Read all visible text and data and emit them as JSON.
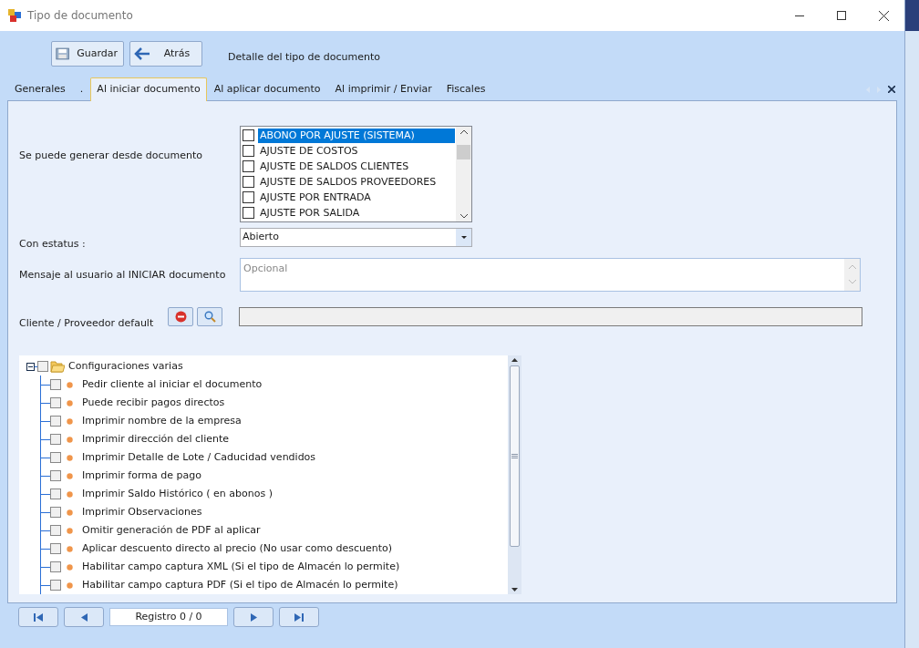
{
  "window": {
    "title": "Tipo de documento"
  },
  "toolbar": {
    "buttons": [
      {
        "label": "Guardar",
        "kind": "save"
      },
      {
        "label": "Atrás",
        "kind": "back"
      }
    ],
    "heading": "Detalle del tipo de documento"
  },
  "tabs": [
    {
      "label": "Generales",
      "selected": false
    },
    {
      "label": ".",
      "selected": false
    },
    {
      "label": "Al iniciar documento",
      "selected": true
    },
    {
      "label": "Al aplicar documento",
      "selected": false
    },
    {
      "label": "Al imprimir / Enviar",
      "selected": false
    },
    {
      "label": "Fiscales",
      "selected": false
    }
  ],
  "form": {
    "generate_from": {
      "label": "Se puede generar desde documento",
      "items": [
        {
          "label": "ABONO POR AJUSTE (SISTEMA)",
          "checked": false,
          "selected": true
        },
        {
          "label": "AJUSTE DE COSTOS",
          "checked": false,
          "selected": false
        },
        {
          "label": "AJUSTE DE SALDOS CLIENTES",
          "checked": false,
          "selected": false
        },
        {
          "label": "AJUSTE DE SALDOS PROVEEDORES",
          "checked": false,
          "selected": false
        },
        {
          "label": "AJUSTE POR ENTRADA",
          "checked": false,
          "selected": false
        },
        {
          "label": "AJUSTE POR SALIDA",
          "checked": false,
          "selected": false
        }
      ]
    },
    "status": {
      "label": "Con estatus :",
      "value": "Abierto"
    },
    "message": {
      "label": "Mensaje al usuario al INICIAR documento",
      "placeholder": "Opcional"
    },
    "partner": {
      "label": "Cliente / Proveedor default"
    }
  },
  "tree": {
    "label": "Configuraciones varias",
    "expanded": true,
    "checked": false,
    "children": [
      {
        "label": "Pedir cliente al iniciar el documento",
        "checked": false
      },
      {
        "label": "Puede recibir pagos directos",
        "checked": false
      },
      {
        "label": "Imprimir nombre de la empresa",
        "checked": false
      },
      {
        "label": "Imprimir dirección del cliente",
        "checked": false
      },
      {
        "label": "Imprimir Detalle de Lote / Caducidad vendidos",
        "checked": false
      },
      {
        "label": "Imprimir forma de pago",
        "checked": false
      },
      {
        "label": "Imprimir Saldo Histórico ( en abonos )",
        "checked": false
      },
      {
        "label": "Imprimir Observaciones",
        "checked": false
      },
      {
        "label": "Omitir generación de PDF al aplicar",
        "checked": false
      },
      {
        "label": "Aplicar descuento directo al precio (No usar como descuento)",
        "checked": false
      },
      {
        "label": "Habilitar campo captura XML (Si el tipo de Almacén lo permite)",
        "checked": false
      },
      {
        "label": "Habilitar campo captura PDF (Si el tipo de Almacén lo permite)",
        "checked": false
      }
    ]
  },
  "navigator": {
    "record": "Registro 0 / 0"
  }
}
